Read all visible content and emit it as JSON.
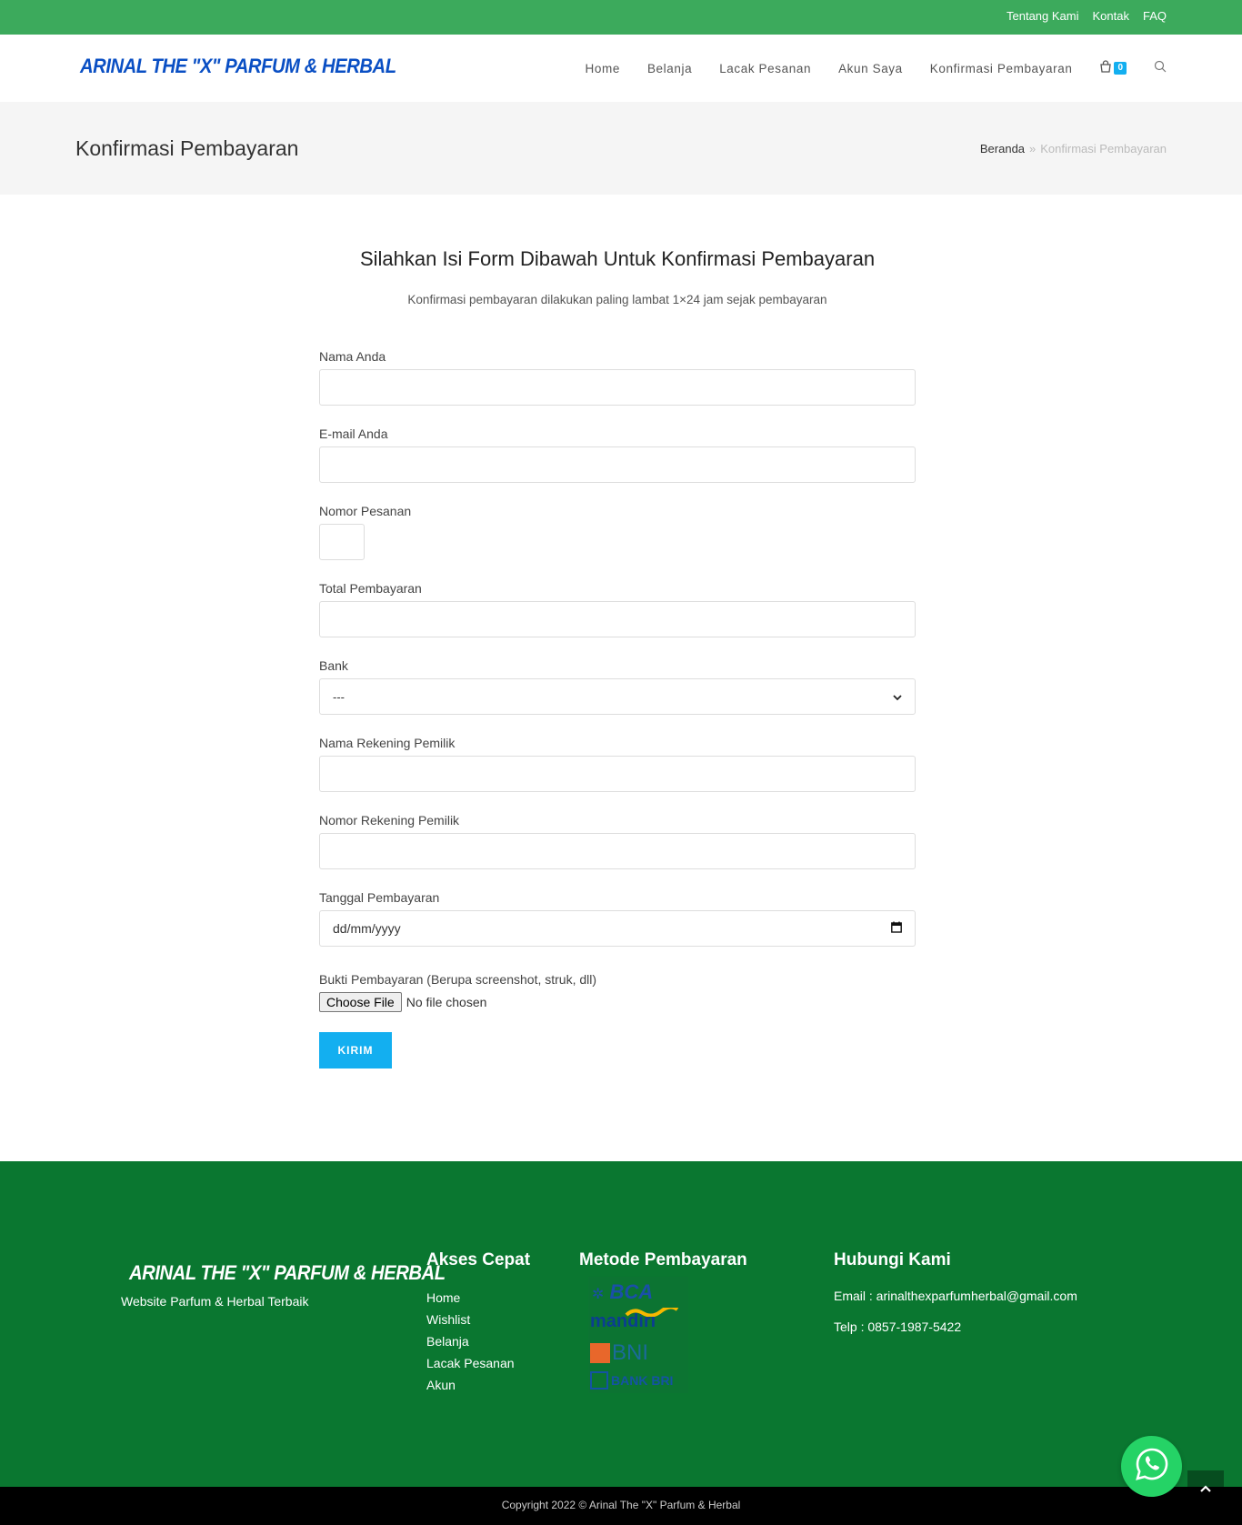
{
  "topbar": {
    "links": [
      "Tentang Kami",
      "Kontak",
      "FAQ"
    ]
  },
  "header": {
    "logo": "ARINAL THE \"X\" PARFUM & HERBAL",
    "nav": [
      "Home",
      "Belanja",
      "Lacak Pesanan",
      "Akun Saya",
      "Konfirmasi Pembayaran"
    ],
    "cart_count": "0",
    "cart_icon": "shopping-bag-icon",
    "search_icon": "search-icon"
  },
  "page_header": {
    "title": "Konfirmasi Pembayaran",
    "breadcrumb_home": "Beranda",
    "breadcrumb_sep": "»",
    "breadcrumb_current": "Konfirmasi Pembayaran"
  },
  "main": {
    "title": "Silahkan Isi Form Dibawah Untuk Konfirmasi Pembayaran",
    "subtitle": "Konfirmasi pembayaran dilakukan paling lambat 1×24 jam sejak pembayaran"
  },
  "form": {
    "name_label": "Nama Anda",
    "email_label": "E-mail Anda",
    "order_label": "Nomor Pesanan",
    "total_label": "Total Pembayaran",
    "bank_label": "Bank",
    "bank_selected": "---",
    "account_name_label": "Nama Rekening Pemilik",
    "account_number_label": "Nomor Rekening Pemilik",
    "date_label": "Tanggal Pembayaran",
    "date_placeholder": "dd/mm/yyyy",
    "proof_label": "Bukti Pembayaran (Berupa screenshot, struk, dll)",
    "file_button": "Choose File",
    "file_status": "No file chosen",
    "submit": "KIRIM"
  },
  "footer": {
    "logo": "ARINAL THE \"X\" PARFUM & HERBAL",
    "tagline": "Website Parfum & Herbal Terbaik",
    "quick_title": "Akses Cepat",
    "quick_links": [
      "Home",
      "Wishlist",
      "Belanja",
      "Lacak Pesanan",
      "Akun"
    ],
    "payment_title": "Metode Pembayaran",
    "banks": [
      "BCA",
      "mandiri",
      "BNI",
      "BANK BRI"
    ],
    "contact_title": "Hubungi Kami",
    "email": "Email : arinalthexparfumherbal@gmail.com",
    "phone": "Telp : 0857-1987-5422",
    "copyright": "Copyright 2022 © Arinal The \"X\" Parfum & Herbal"
  },
  "colors": {
    "topbar": "#3caa5c",
    "accent": "#13aff0",
    "logo": "#0a4fc4",
    "footer": "#0a7730",
    "whatsapp": "#25d366"
  }
}
